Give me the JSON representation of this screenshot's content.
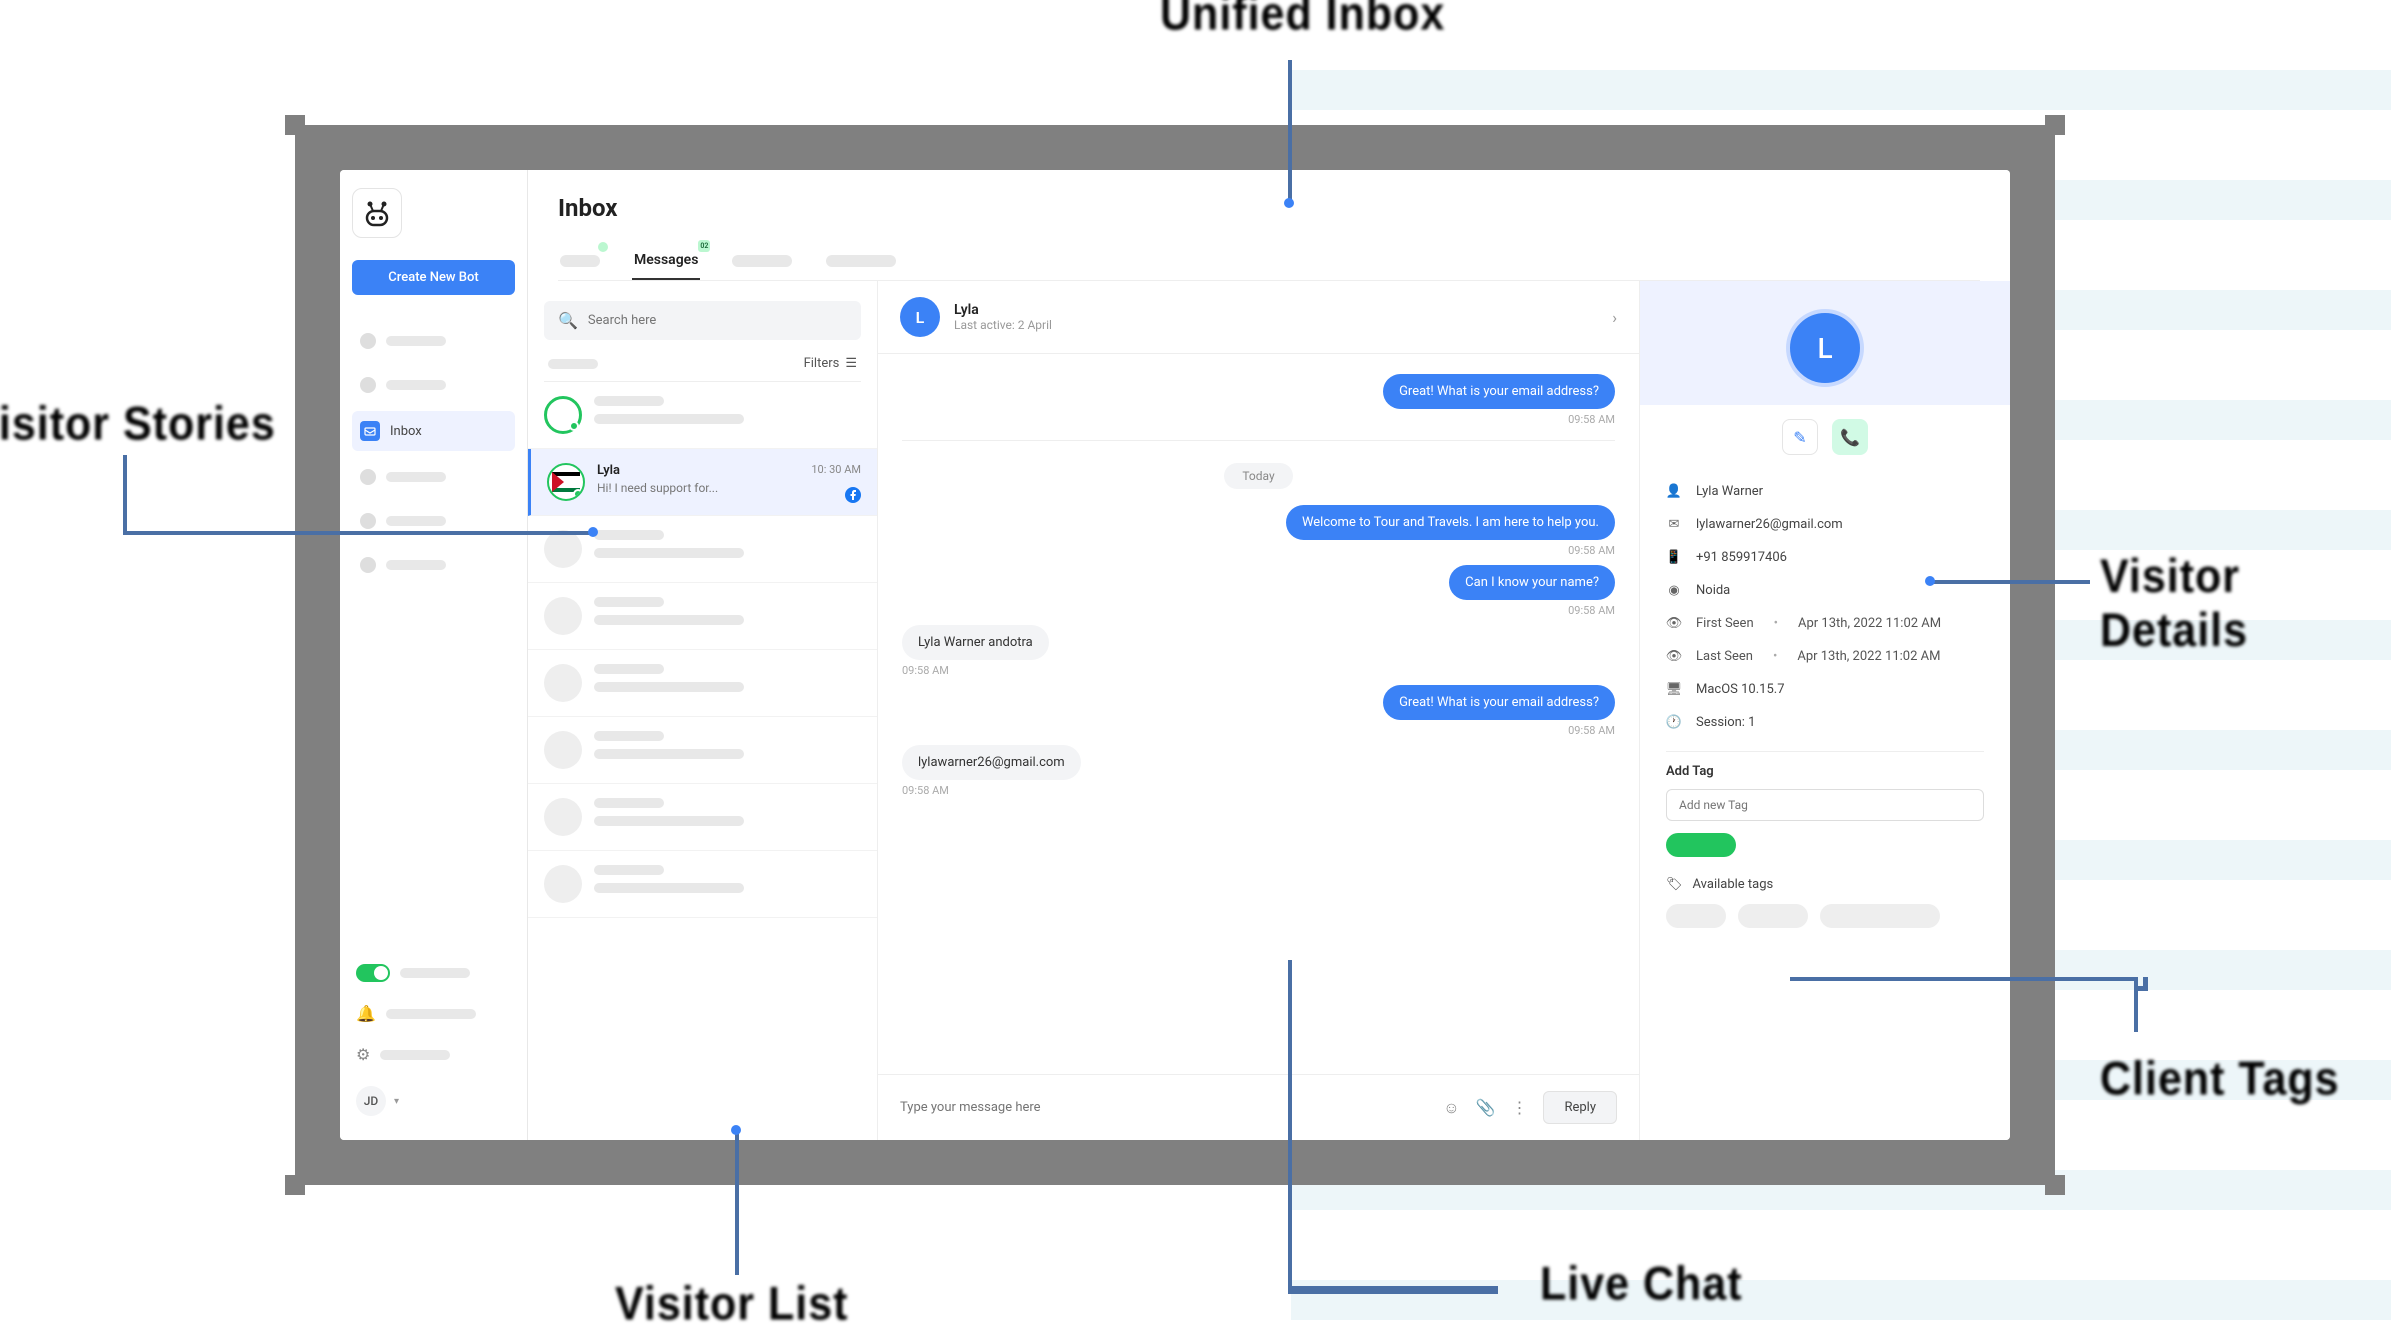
{
  "sidebar": {
    "create_btn": "Create New Bot",
    "inbox_label": "Inbox",
    "avatar_initials": "JD"
  },
  "header": {
    "title": "Inbox",
    "tabs": {
      "messages": "Messages",
      "badge": "02"
    }
  },
  "vlist": {
    "search_placeholder": "Search here",
    "filters_label": "Filters",
    "selected": {
      "name": "Lyla",
      "preview": "Hi! I need support for...",
      "time": "10: 30 AM"
    }
  },
  "chat": {
    "header": {
      "name": "Lyla",
      "sub": "Last active: 2 April",
      "initial": "L"
    },
    "date_divider": "Today",
    "messages": [
      {
        "dir": "out",
        "text": "Great! What is your email address?",
        "time": "09:58 AM"
      },
      {
        "dir": "out",
        "text": "Welcome to Tour and Travels. I am here to help you.",
        "time": "09:58 AM"
      },
      {
        "dir": "out",
        "text": "Can I know your name?",
        "time": "09:58 AM"
      },
      {
        "dir": "in",
        "text": "Lyla Warner andotra",
        "time": "09:58 AM"
      },
      {
        "dir": "out",
        "text": "Great! What is your email address?",
        "time": "09:58 AM"
      },
      {
        "dir": "in",
        "text": "lylawarner26@gmail.com",
        "time": "09:58 AM"
      }
    ],
    "input_placeholder": "Type your message here",
    "reply_btn": "Reply"
  },
  "details": {
    "initial": "L",
    "name": "Lyla Warner",
    "email": "lylawarner26@gmail.com",
    "phone": "+91 859917406",
    "location": "Noida",
    "first_seen_label": "First Seen",
    "first_seen_val": "Apr 13th, 2022 11:02 AM",
    "last_seen_label": "Last Seen",
    "last_seen_val": "Apr 13th, 2022 11:02 AM",
    "os": "MacOS 10.15.7",
    "session": "Session: 1",
    "add_tag_label": "Add Tag",
    "tag_placeholder": "Add new Tag",
    "available_tags_label": "Available tags"
  },
  "annotations": {
    "unified_inbox": "Unified Inbox",
    "visitor_stories": "Visitor Stories",
    "visitor_list": "Visitor List",
    "live_chat": "Live Chat",
    "visitor_details": "Visitor Details",
    "client_tags": "Client Tags"
  }
}
